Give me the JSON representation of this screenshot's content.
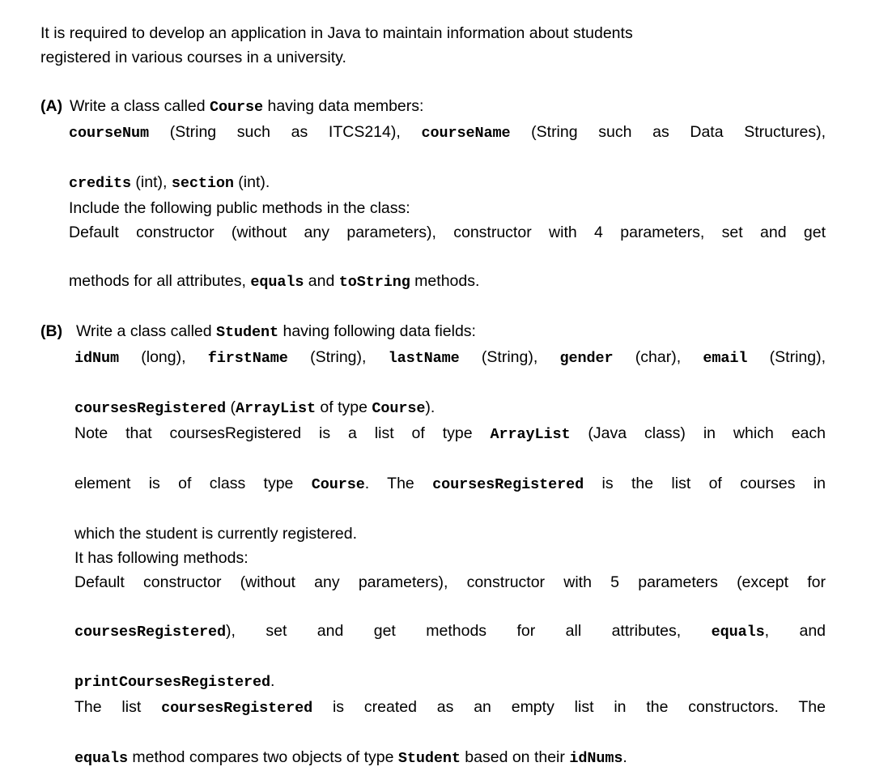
{
  "document": {
    "intro": {
      "line1": "It is required to develop an application in Java to maintain information about students",
      "line2": "registered in various courses in a university."
    },
    "questions": [
      {
        "label": "(A)",
        "lines": [
          {
            "id": "a1",
            "justify": false,
            "parts": [
              {
                "text": "Write a class called ",
                "code": false
              },
              {
                "text": "Course",
                "code": true
              },
              {
                "text": " having data members:",
                "code": false
              }
            ]
          },
          {
            "id": "a2",
            "justify": true,
            "parts": [
              {
                "text": "courseNum",
                "code": true
              },
              {
                "text": " (String such as ITCS214), ",
                "code": false
              },
              {
                "text": "courseName",
                "code": true
              },
              {
                "text": " (String such as Data Structures),",
                "code": false
              }
            ]
          },
          {
            "id": "a3",
            "justify": false,
            "parts": [
              {
                "text": "credits",
                "code": true
              },
              {
                "text": " (int), ",
                "code": false
              },
              {
                "text": "section",
                "code": true
              },
              {
                "text": " (int).",
                "code": false
              }
            ]
          },
          {
            "id": "a4",
            "justify": false,
            "parts": [
              {
                "text": "Include the following public methods in the class:",
                "code": false
              }
            ]
          },
          {
            "id": "a5",
            "justify": true,
            "parts": [
              {
                "text": "Default constructor (without any parameters), constructor with 4 parameters, set and get",
                "code": false
              }
            ]
          },
          {
            "id": "a6",
            "justify": false,
            "parts": [
              {
                "text": "methods for all attributes, ",
                "code": false
              },
              {
                "text": "equals",
                "code": true
              },
              {
                "text": " and ",
                "code": false
              },
              {
                "text": "toString",
                "code": true
              },
              {
                "text": " methods.",
                "code": false
              }
            ]
          }
        ]
      },
      {
        "label": "(B)",
        "lines": [
          {
            "id": "b1",
            "justify": false,
            "parts": [
              {
                "text": "Write a class called ",
                "code": false
              },
              {
                "text": "Student",
                "code": true
              },
              {
                "text": " having following data fields:",
                "code": false
              }
            ]
          },
          {
            "id": "b2",
            "justify": true,
            "parts": [
              {
                "text": "idNum",
                "code": true
              },
              {
                "text": " (long), ",
                "code": false
              },
              {
                "text": "firstName",
                "code": true
              },
              {
                "text": " (String), ",
                "code": false
              },
              {
                "text": "lastName",
                "code": true
              },
              {
                "text": " (String), ",
                "code": false
              },
              {
                "text": "gender",
                "code": true
              },
              {
                "text": " (char), ",
                "code": false
              },
              {
                "text": "email",
                "code": true
              },
              {
                "text": " (String),",
                "code": false
              }
            ]
          },
          {
            "id": "b3",
            "justify": false,
            "parts": [
              {
                "text": "coursesRegistered",
                "code": true
              },
              {
                "text": "  (",
                "code": false
              },
              {
                "text": "ArrayList",
                "code": true
              },
              {
                "text": " of type ",
                "code": false
              },
              {
                "text": "Course",
                "code": true
              },
              {
                "text": ").",
                "code": false
              }
            ]
          },
          {
            "id": "b4",
            "justify": true,
            "parts": [
              {
                "text": "Note that coursesRegistered is a list of type ",
                "code": false
              },
              {
                "text": "ArrayList",
                "code": true
              },
              {
                "text": " (Java class) in which each",
                "code": false
              }
            ]
          },
          {
            "id": "b5",
            "justify": true,
            "parts": [
              {
                "text": "element is of class type ",
                "code": false
              },
              {
                "text": "Course",
                "code": true
              },
              {
                "text": ". The ",
                "code": false
              },
              {
                "text": "coursesRegistered",
                "code": true
              },
              {
                "text": " is the list of courses in",
                "code": false
              }
            ]
          },
          {
            "id": "b6",
            "justify": false,
            "parts": [
              {
                "text": "which the student is currently registered.",
                "code": false
              }
            ]
          },
          {
            "id": "b7",
            "justify": false,
            "parts": [
              {
                "text": "It has following methods:",
                "code": false
              }
            ]
          },
          {
            "id": "b8",
            "justify": true,
            "parts": [
              {
                "text": "Default constructor (without any parameters), constructor with 5 parameters (except for",
                "code": false
              }
            ]
          },
          {
            "id": "b9",
            "justify": true,
            "parts": [
              {
                "text": "coursesRegistered",
                "code": true
              },
              {
                "text": "), set and get methods for all attributes, ",
                "code": false
              },
              {
                "text": "equals",
                "code": true
              },
              {
                "text": ", and",
                "code": false
              }
            ]
          },
          {
            "id": "b10",
            "justify": false,
            "parts": [
              {
                "text": "printCoursesRegistered",
                "code": true
              },
              {
                "text": ".",
                "code": false
              }
            ]
          },
          {
            "id": "b11",
            "justify": true,
            "parts": [
              {
                "text": "The list ",
                "code": false
              },
              {
                "text": "coursesRegistered",
                "code": true
              },
              {
                "text": " is created as an empty list in the constructors. The",
                "code": false
              }
            ]
          },
          {
            "id": "b12",
            "justify": false,
            "parts": [
              {
                "text": "equals",
                "code": true
              },
              {
                "text": " method compares two objects of type ",
                "code": false
              },
              {
                "text": "Student",
                "code": true
              },
              {
                "text": " based on their ",
                "code": false
              },
              {
                "text": "idNums",
                "code": true
              },
              {
                "text": ".",
                "code": false
              }
            ]
          }
        ]
      }
    ]
  }
}
